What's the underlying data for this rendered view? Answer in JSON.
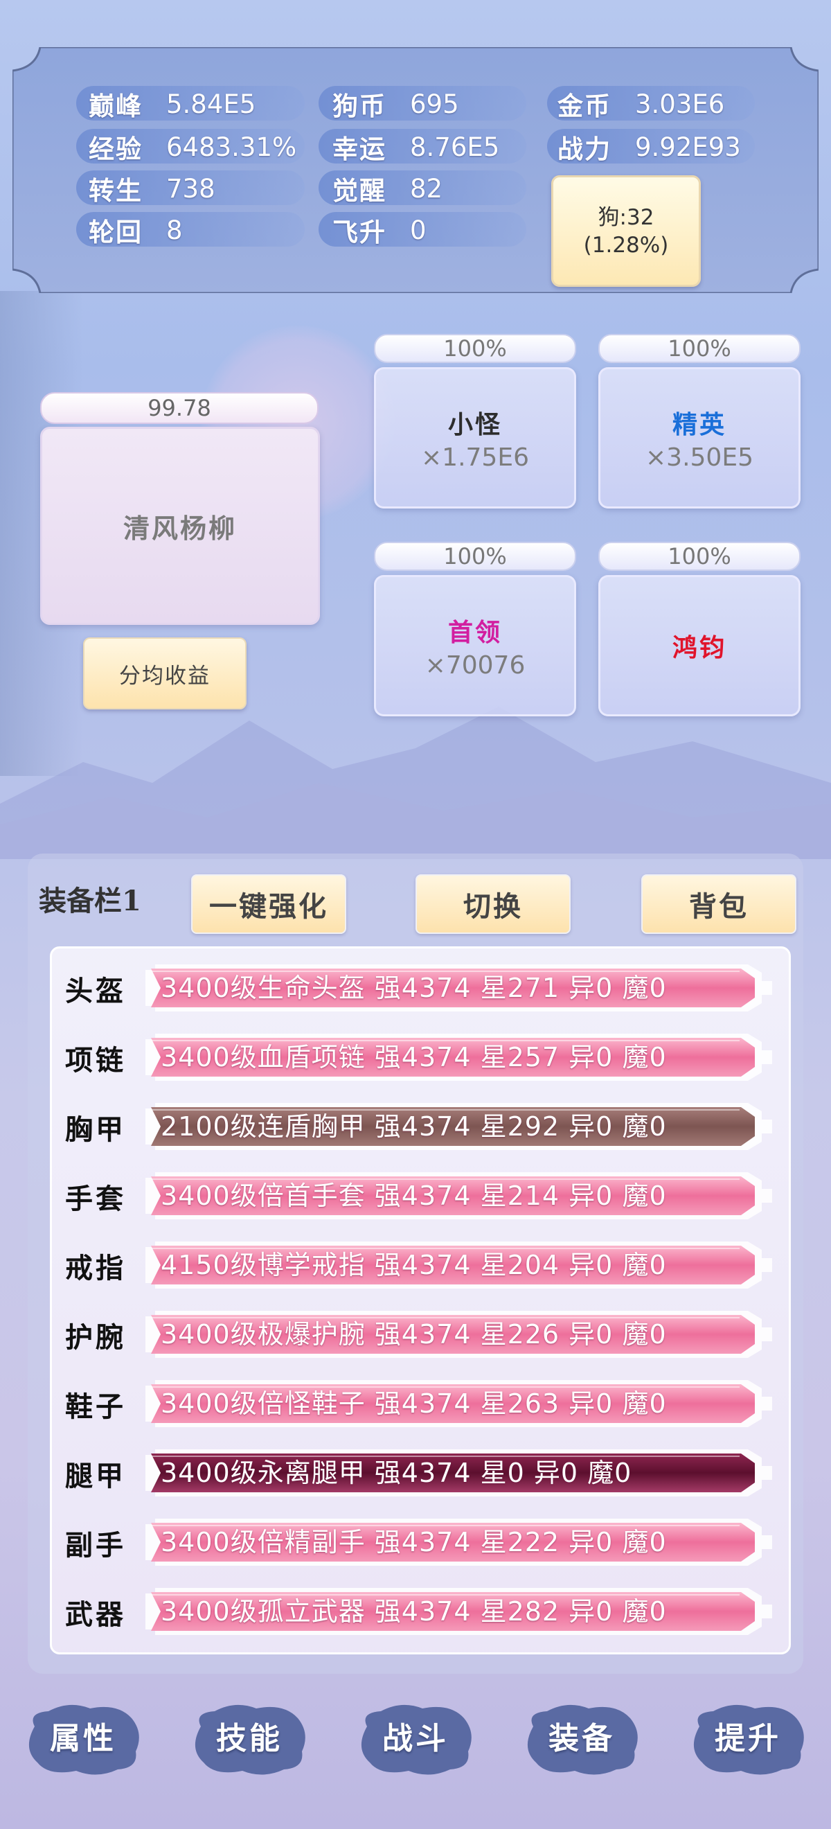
{
  "stats": [
    {
      "label": "巅峰",
      "value": "5.84E5"
    },
    {
      "label": "狗币",
      "value": "695"
    },
    {
      "label": "金币",
      "value": "3.03E6"
    },
    {
      "label": "经验",
      "value": "6483.31%"
    },
    {
      "label": "幸运",
      "value": "8.76E5"
    },
    {
      "label": "战力",
      "value": "9.92E93"
    },
    {
      "label": "转生",
      "value": "738"
    },
    {
      "label": "觉醒",
      "value": "82"
    },
    {
      "label": "轮回",
      "value": "8"
    },
    {
      "label": "飞升",
      "value": "0"
    }
  ],
  "dog_button": {
    "line1": "狗:32",
    "line2": "(1.28%)"
  },
  "boss": {
    "progress": "99.78",
    "name": "清风杨柳",
    "share_label": "分均收益"
  },
  "monsters": [
    {
      "progress": "100%",
      "name": "小怪",
      "count": "×1.75E6",
      "color": "#2d2d2d"
    },
    {
      "progress": "100%",
      "name": "精英",
      "count": "×3.50E5",
      "color": "#1a6fd9"
    },
    {
      "progress": "100%",
      "name": "首领",
      "count": "×70076",
      "color": "#d21ea0"
    },
    {
      "progress": "100%",
      "name": "鸿钧",
      "count": "",
      "color": "#e0142b"
    }
  ],
  "equipment": {
    "title": "装备栏1",
    "buttons": {
      "upgrade": "一键强化",
      "switch": "切换",
      "bag": "背包"
    },
    "slots": [
      {
        "slot": "头盔",
        "text": "3400级生命头盔  强4374  星271  异0  魔0",
        "style": "pink"
      },
      {
        "slot": "项链",
        "text": "3400级血盾项链  强4374  星257  异0  魔0",
        "style": "pink"
      },
      {
        "slot": "胸甲",
        "text": "2100级连盾胸甲  强4374  星292  异0  魔0",
        "style": "brown"
      },
      {
        "slot": "手套",
        "text": "3400级倍首手套  强4374  星214  异0  魔0",
        "style": "pink"
      },
      {
        "slot": "戒指",
        "text": "4150级博学戒指  强4374  星204  异0  魔0",
        "style": "pink"
      },
      {
        "slot": "护腕",
        "text": "3400级极爆护腕  强4374  星226  异0  魔0",
        "style": "pink"
      },
      {
        "slot": "鞋子",
        "text": "3400级倍怪鞋子  强4374  星263  异0  魔0",
        "style": "pink"
      },
      {
        "slot": "腿甲",
        "text": "3400级永离腿甲  强4374  星0  异0  魔0",
        "style": "maroon"
      },
      {
        "slot": "副手",
        "text": "3400级倍精副手  强4374  星222  异0  魔0",
        "style": "pink"
      },
      {
        "slot": "武器",
        "text": "3400级孤立武器  强4374  星282  异0  魔0",
        "style": "pink"
      }
    ]
  },
  "nav": [
    "属性",
    "技能",
    "战斗",
    "装备",
    "提升"
  ],
  "colors": {
    "pink_bar": "#f07fa6",
    "brown_bar": "#8e6562",
    "maroon_bar": "#7a1a40",
    "accent_gold": "#fde2ad"
  }
}
